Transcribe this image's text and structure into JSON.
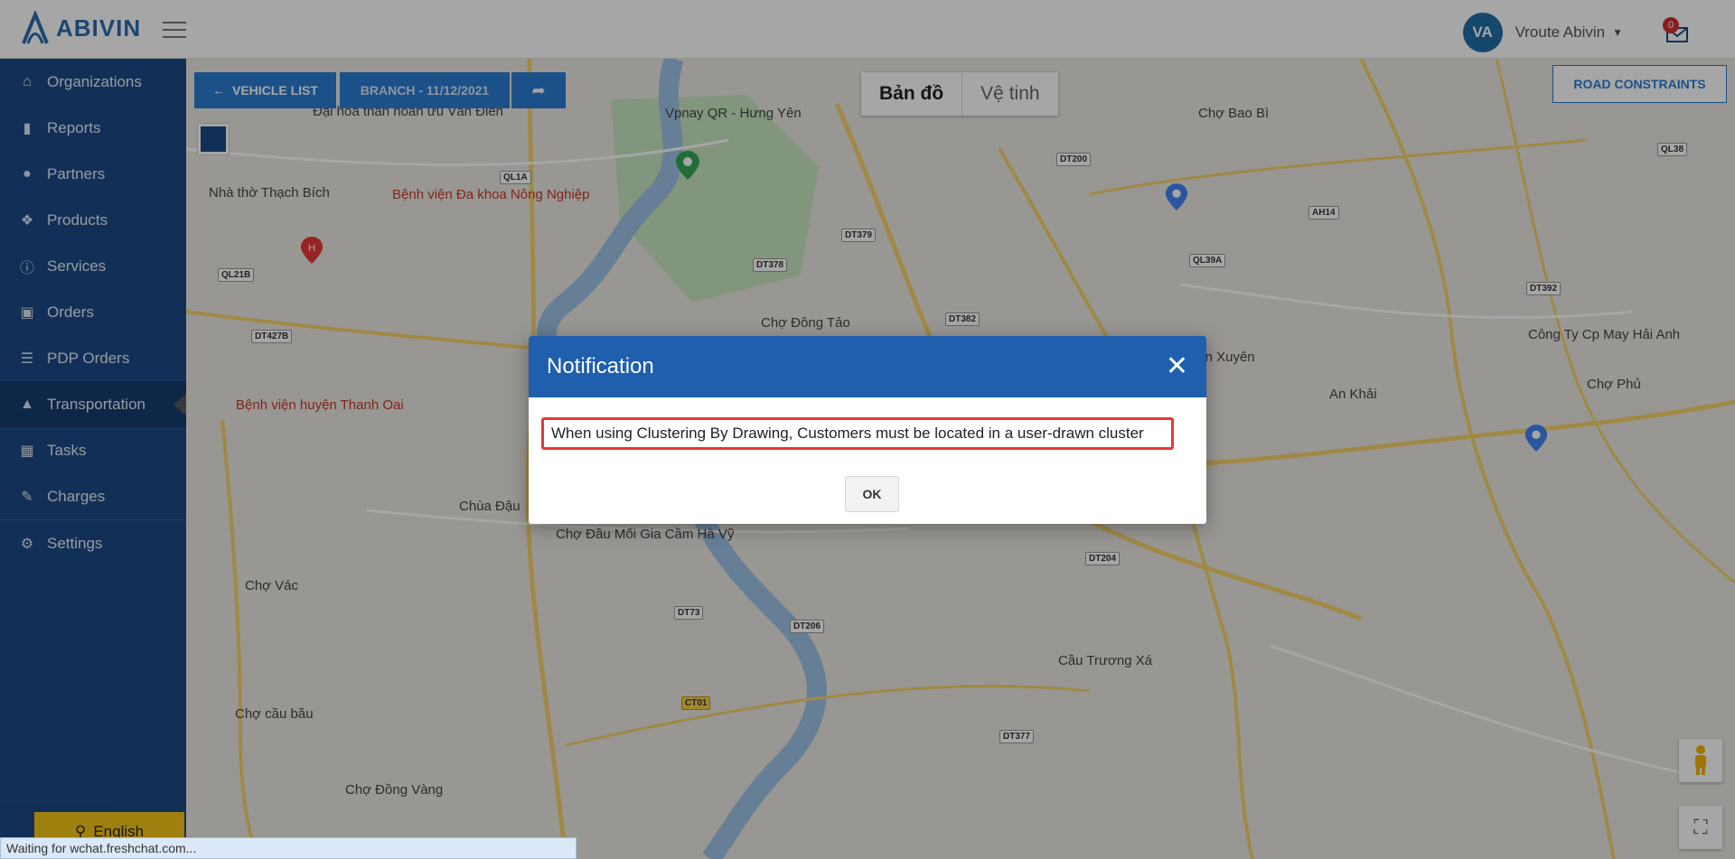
{
  "header": {
    "logo_text": "ABIVIN",
    "user_initials": "VA",
    "user_name": "Vroute Abivin",
    "notification_count": "0"
  },
  "sidebar": {
    "items": [
      {
        "label": "Organizations",
        "icon": "home-icon"
      },
      {
        "label": "Reports",
        "icon": "bar-chart-icon"
      },
      {
        "label": "Partners",
        "icon": "users-icon"
      },
      {
        "label": "Products",
        "icon": "dropbox-icon"
      },
      {
        "label": "Services",
        "icon": "info-icon"
      },
      {
        "label": "Orders",
        "icon": "cubes-icon"
      },
      {
        "label": "PDP Orders",
        "icon": "list-icon"
      },
      {
        "label": "Transportation",
        "icon": "road-icon"
      },
      {
        "label": "Tasks",
        "icon": "calendar-icon"
      },
      {
        "label": "Charges",
        "icon": "hand-money-icon"
      },
      {
        "label": "Settings",
        "icon": "gear-icon"
      }
    ],
    "language_label": "English"
  },
  "toolbar": {
    "vehicle_list_label": "VEHICLE LIST",
    "branch_label": "BRANCH - 11/12/2021",
    "map_type_map": "Bản đồ",
    "map_type_satellite": "Vệ tinh",
    "road_constraints_label": "ROAD CONSTRAINTS"
  },
  "map": {
    "places": [
      "Vpnay QR - Hưng Yên",
      "Chợ Bao Bì",
      "Bệnh viện Đa khoa Nông Nghiệp",
      "Nhà thờ Thạch Bích",
      "Chợ Đông Tảo",
      "Cầu Thuần Xuyên",
      "Công Ty Cp May Hải Anh",
      "Chợ Phủ",
      "Bệnh viện huyện Thanh Oai",
      "An Khải",
      "Chùa Đậu",
      "Chợ Đầu Mối Gia Cầm Hà Vỹ",
      "Chợ Vác",
      "Cầu Trương Xá",
      "Chợ cầu bầu",
      "Chợ Đồng Vàng",
      "Đại hoa thân hoàn ưu Văn Điển"
    ],
    "roads": [
      "QL1A",
      "DT378",
      "DT379",
      "DT200",
      "AH14",
      "QL39A",
      "DT382",
      "DT392",
      "QL38",
      "QL21B",
      "DT427B",
      "DT377",
      "DT204",
      "DT206",
      "DT73",
      "CT01"
    ]
  },
  "modal": {
    "title": "Notification",
    "message": "When using Clustering By Drawing, Customers must be located in a user-drawn cluster",
    "ok_label": "OK"
  },
  "status_bar": {
    "text": "Waiting for wchat.freshchat.com..."
  },
  "colors": {
    "sidebar": "#1d4a86",
    "primary": "#2a7dd1",
    "modal_header": "#1f5fad",
    "highlight_border": "#e53935"
  }
}
